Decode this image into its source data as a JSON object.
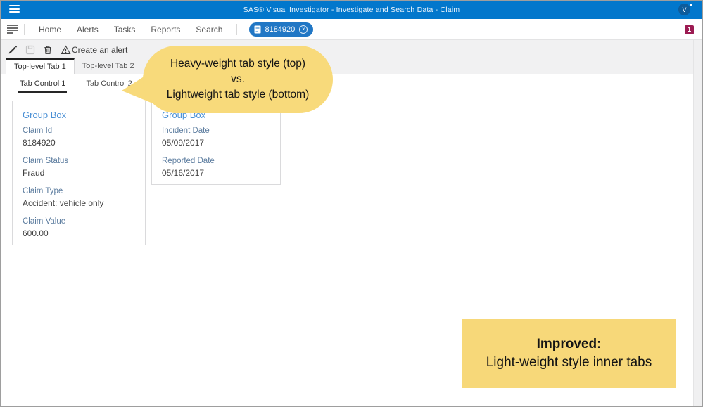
{
  "titlebar": {
    "title": "SAS® Visual Investigator - Investigate and Search Data - Claim",
    "avatar_initial": "V"
  },
  "nav": {
    "items": [
      "Home",
      "Alerts",
      "Tasks",
      "Reports",
      "Search"
    ],
    "entity_tab": {
      "label": "8184920",
      "close": "×"
    },
    "alert_badge": "1"
  },
  "toolbar": {
    "create_alert_label": "Create an alert"
  },
  "tabs": {
    "top": [
      {
        "label": "Top-level Tab 1",
        "active": true
      },
      {
        "label": "Top-level Tab 2",
        "active": false
      }
    ],
    "inner": [
      {
        "label": "Tab Control 1",
        "active": true
      },
      {
        "label": "Tab Control 2",
        "active": false
      }
    ]
  },
  "group_boxes": [
    {
      "title": "Group Box",
      "fields": [
        {
          "label": "Claim Id",
          "value": "8184920"
        },
        {
          "label": "Claim Status",
          "value": "Fraud"
        },
        {
          "label": "Claim Type",
          "value": "Accident: vehicle only"
        },
        {
          "label": "Claim Value",
          "value": "600.00"
        }
      ]
    },
    {
      "title": "Group Box",
      "fields": [
        {
          "label": "Incident Date",
          "value": "05/09/2017"
        },
        {
          "label": "Reported Date",
          "value": "05/16/2017"
        }
      ]
    }
  ],
  "callout": {
    "line1": "Heavy-weight tab style (top)",
    "line2": "vs.",
    "line3": "Lightweight tab style (bottom)"
  },
  "note": {
    "heading": "Improved:",
    "body": "Light-weight style inner tabs"
  },
  "colors": {
    "titlebar_blue": "#0277CC",
    "entity_pill_blue": "#2177C5",
    "chrome_gray": "#F1F1F2",
    "callout_yellow": "#F8DA7B",
    "note_yellow": "#F7D879",
    "badge_maroon": "#9C1B52",
    "group_title_blue": "#4A90D5",
    "field_label_blue": "#5E7EA0"
  }
}
